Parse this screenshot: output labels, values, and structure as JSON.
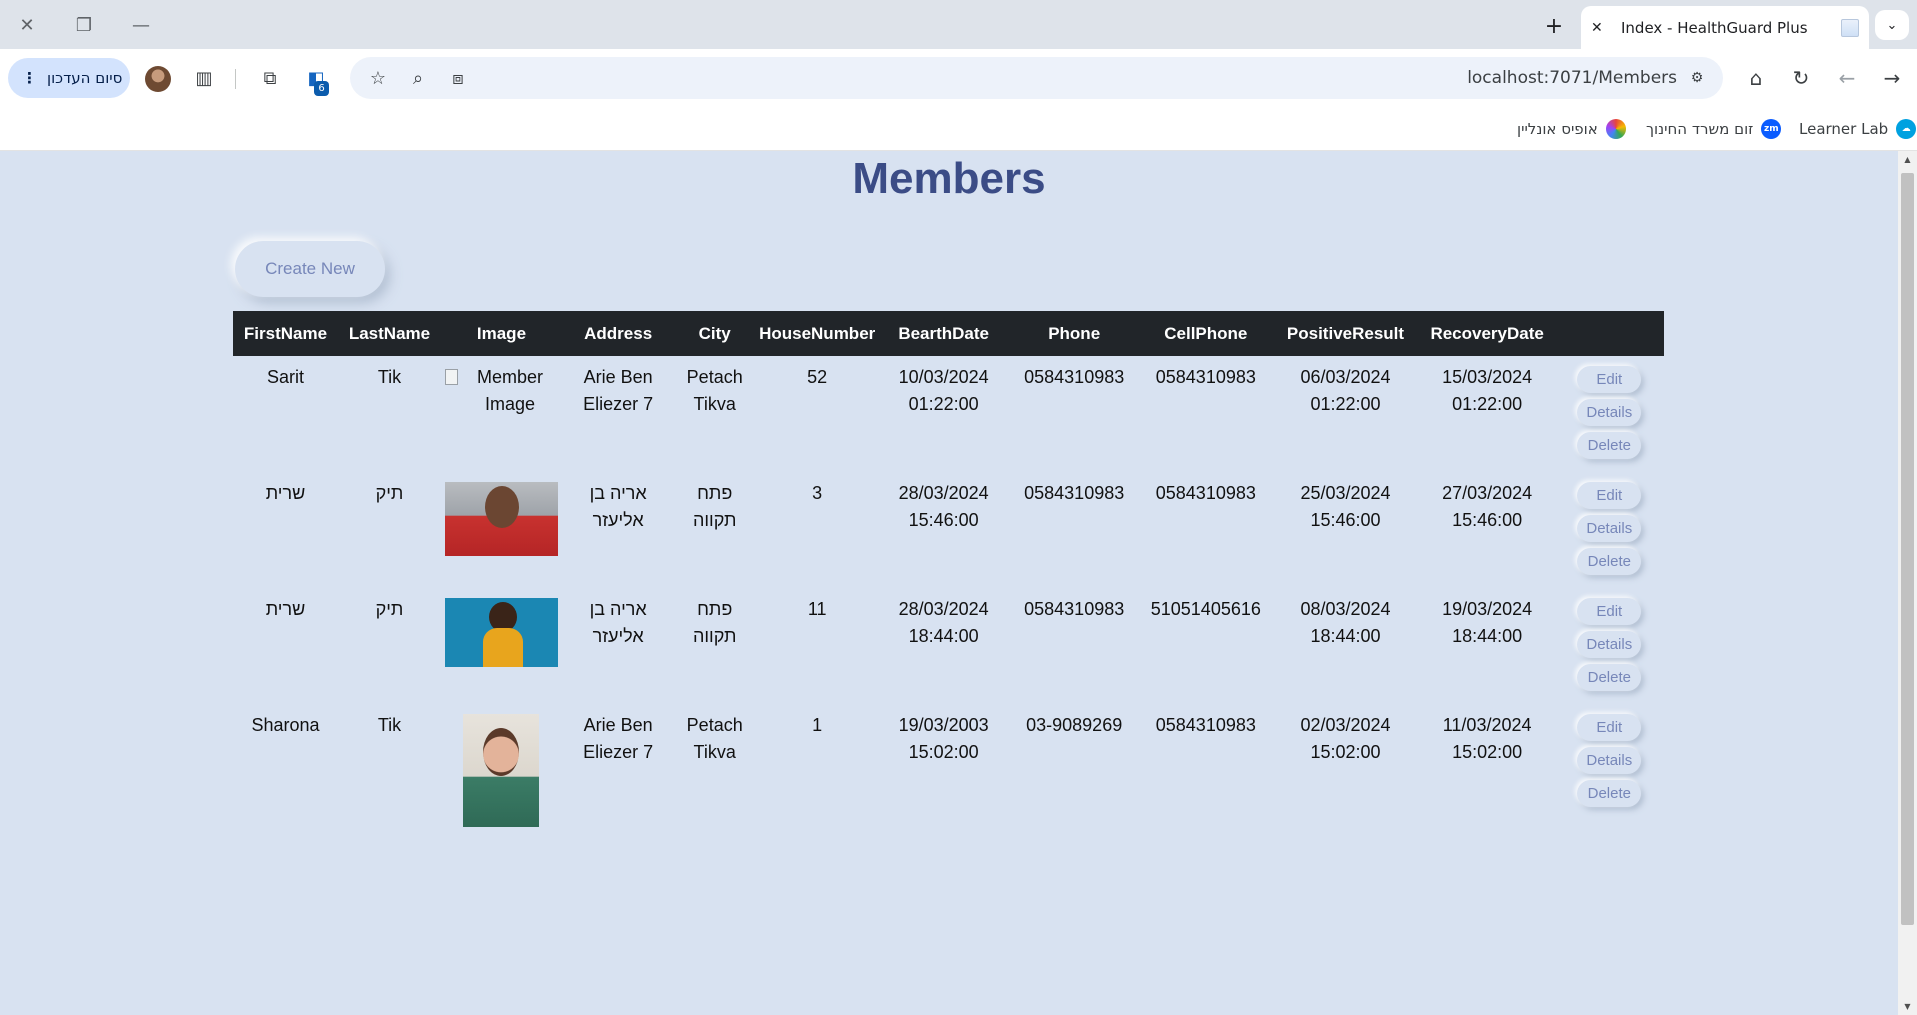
{
  "browser": {
    "tab_title": "Index - HealthGuard Plus",
    "update_button": "סיום העדכון",
    "extension_badge": "6",
    "url": "localhost:7071/Members",
    "bookmarks": [
      {
        "label": "Learner Lab"
      },
      {
        "label": "זום משרד החינוך"
      },
      {
        "label": "אופיס אונליין"
      }
    ]
  },
  "page": {
    "title": "Members",
    "create_new": "Create New"
  },
  "table": {
    "headers": [
      "FirstName",
      "LastName",
      "Image",
      "Address",
      "City",
      "HouseNumber",
      "BearthDate",
      "Phone",
      "CellPhone",
      "PositiveResult",
      "RecoveryDate"
    ],
    "rows": [
      {
        "first_name": "Sarit",
        "last_name": "Tik",
        "image_alt": "Member Image",
        "address": "Arie Ben Eliezer 7",
        "city": "Petach Tikva",
        "house_number": "52",
        "birth_date": "10/03/2024",
        "birth_time": "01:22:00",
        "phone": "0584310983",
        "cell_phone": "0584310983",
        "positive_date": "06/03/2024",
        "positive_time": "01:22:00",
        "recovery_date": "15/03/2024",
        "recovery_time": "01:22:00"
      },
      {
        "first_name": "שרית",
        "last_name": "תיק",
        "image_alt": "",
        "address": "אריה בן אליעזר",
        "city": "פתח תקווה",
        "house_number": "3",
        "birth_date": "28/03/2024",
        "birth_time": "15:46:00",
        "phone": "0584310983",
        "cell_phone": "0584310983",
        "positive_date": "25/03/2024",
        "positive_time": "15:46:00",
        "recovery_date": "27/03/2024",
        "recovery_time": "15:46:00"
      },
      {
        "first_name": "שרית",
        "last_name": "תיק",
        "image_alt": "",
        "address": "אריה בן אליעזר",
        "city": "פתח תקווה",
        "house_number": "11",
        "birth_date": "28/03/2024",
        "birth_time": "18:44:00",
        "phone": "0584310983",
        "cell_phone": "51051405616",
        "positive_date": "08/03/2024",
        "positive_time": "18:44:00",
        "recovery_date": "19/03/2024",
        "recovery_time": "18:44:00"
      },
      {
        "first_name": "Sharona",
        "last_name": "Tik",
        "image_alt": "",
        "address": "Arie Ben Eliezer 7",
        "city": "Petach Tikva",
        "house_number": "1",
        "birth_date": "19/03/2003",
        "birth_time": "15:02:00",
        "phone": "03-9089269",
        "cell_phone": "0584310983",
        "positive_date": "02/03/2024",
        "positive_time": "15:02:00",
        "recovery_date": "11/03/2024",
        "recovery_time": "15:02:00"
      }
    ],
    "actions": [
      "Edit",
      "Details",
      "Delete"
    ]
  },
  "colors": {
    "page_background": "#d8e2f1",
    "title": "#3b4c86",
    "header_background": "#212529",
    "button_text": "#7787b9"
  }
}
